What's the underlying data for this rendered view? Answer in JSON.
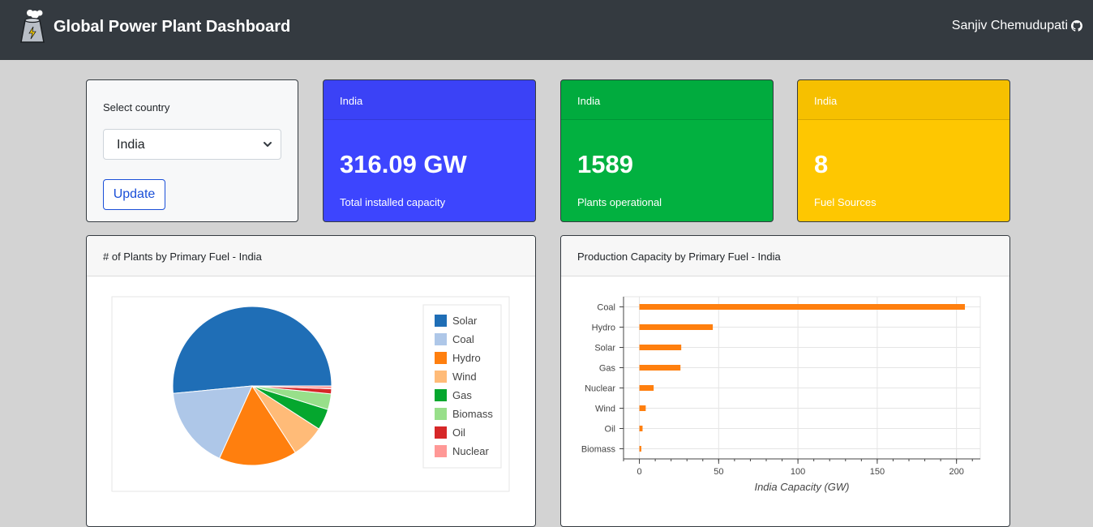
{
  "navbar": {
    "title": "Global Power Plant Dashboard",
    "user_name": "Sanjiv Chemudupati",
    "user_icon": "github-icon",
    "brand_icon": "power-plant-icon"
  },
  "country_select": {
    "label": "Select country",
    "selected": "India",
    "update_label": "Update"
  },
  "stats": [
    {
      "country": "India",
      "value": "316.09 GW",
      "caption": "Total installed capacity",
      "color": "#3d45fe"
    },
    {
      "country": "India",
      "value": "1589",
      "caption": "Plants operational",
      "color": "#02b140"
    },
    {
      "country": "India",
      "value": "8",
      "caption": "Fuel Sources",
      "color": "#fec701"
    }
  ],
  "pie_panel": {
    "title": "# of Plants by Primary Fuel - India"
  },
  "bar_panel": {
    "title": "Production Capacity by Primary Fuel - India"
  },
  "chart_data": [
    {
      "type": "pie",
      "title": "# of Plants by Primary Fuel - India",
      "legend_position": "right",
      "categories": [
        "Solar",
        "Coal",
        "Hydro",
        "Wind",
        "Gas",
        "Biomass",
        "Oil",
        "Nuclear"
      ],
      "values": [
        803,
        261,
        248,
        105,
        67,
        50,
        16,
        9
      ],
      "colors": [
        "#1f6eb6",
        "#aec7e8",
        "#ff7f0e",
        "#ffbb78",
        "#05a72e",
        "#98df8a",
        "#d62728",
        "#ff9896"
      ]
    },
    {
      "type": "bar",
      "orientation": "horizontal",
      "title": "Production Capacity by Primary Fuel - India",
      "categories": [
        "Coal",
        "Hydro",
        "Solar",
        "Gas",
        "Nuclear",
        "Wind",
        "Oil",
        "Biomass"
      ],
      "values": [
        205.3,
        46.3,
        26.4,
        25.9,
        9.0,
        4.0,
        2.0,
        1.2
      ],
      "xlabel": "India Capacity (GW)",
      "xlim": [
        -10,
        215
      ],
      "xticks": [
        0,
        50,
        100,
        150,
        200
      ],
      "grid": true,
      "color": "#ff7f0e"
    }
  ]
}
